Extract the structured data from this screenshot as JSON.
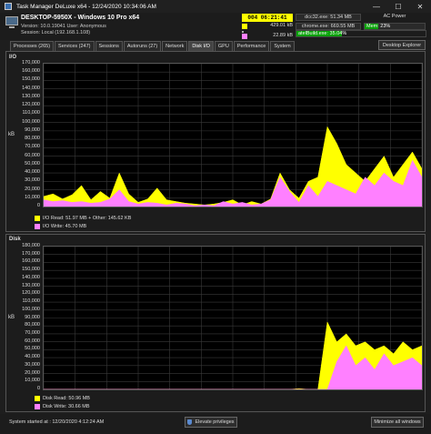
{
  "window": {
    "title": "Task Manager DeLuxe x64 - 12/24/2020 10:34:06 AM",
    "controls": [
      "—",
      "☐",
      "✕"
    ]
  },
  "system": {
    "host": "DESKTOP-5950X - Windows 10 Pro x64",
    "version_line": "Version: 10.0.19041   User: Anonymous",
    "session_line": "Session: Local (192.168.1.108)"
  },
  "status": {
    "clock": "004 06:21:41",
    "stat1_color": "#ffff00",
    "stat1_value": "429.01 kB",
    "stat2_color": "#ff80ff",
    "stat2_value": "22.89 kB",
    "top_procs": [
      "dcc32.exe: 51.34 MB",
      "chrome.exe: 669.55 MB",
      "atelBuild.exe: 35.04%"
    ],
    "power": "AC Power",
    "memory_label": "Mem: 23%",
    "memory_fraction": 0.23,
    "cpu_fraction": 0.35
  },
  "tabs": [
    {
      "label": "Processes (265)",
      "active": false
    },
    {
      "label": "Services (247)",
      "active": false
    },
    {
      "label": "Sessions",
      "active": false
    },
    {
      "label": "Autoruns (27)",
      "active": false
    },
    {
      "label": "Network",
      "active": false
    },
    {
      "label": "Disk I/O",
      "active": true
    },
    {
      "label": "GPU",
      "active": false
    },
    {
      "label": "Performance",
      "active": false
    },
    {
      "label": "System",
      "active": false
    }
  ],
  "desktop_explorer_label": "Desktop Explorer",
  "io_section": {
    "title": "I/O",
    "ylabel": "kB",
    "legend": [
      {
        "color": "#ffff00",
        "label": "I/O Read: 51.97 MB + Other: 145.62 KB"
      },
      {
        "color": "#ff80ff",
        "label": "I/O Write: 45.70 MB"
      }
    ]
  },
  "disk_section": {
    "title": "Disk",
    "ylabel": "kB",
    "legend": [
      {
        "color": "#ffff00",
        "label": "Disk Read: 50.96 MB"
      },
      {
        "color": "#ff80ff",
        "label": "Disk Write: 30.66 MB"
      }
    ]
  },
  "footer": {
    "started": "System started at : 12/20/2020 4:12:24 AM",
    "elevate": "Elevate privileges",
    "minimize": "Minimize all windows"
  },
  "chart_data": [
    {
      "type": "area",
      "title": "I/O",
      "ylabel": "kB",
      "ylim": [
        0,
        170000
      ],
      "yticks": [
        0,
        10000,
        20000,
        30000,
        40000,
        50000,
        60000,
        70000,
        80000,
        90000,
        100000,
        110000,
        120000,
        130000,
        140000,
        150000,
        160000,
        170000
      ],
      "ytick_labels": [
        "0",
        "10,000",
        "20,000",
        "30,000",
        "40,000",
        "50,000",
        "60,000",
        "70,000",
        "80,000",
        "90,000",
        "100,000",
        "110,000",
        "120,000",
        "130,000",
        "140,000",
        "150,000",
        "160,000",
        "170,000"
      ],
      "grid": true,
      "x": [
        0,
        10,
        20,
        30,
        40,
        50,
        60,
        70,
        80,
        90,
        100,
        110,
        120,
        130,
        140,
        150,
        160,
        170,
        180,
        190,
        200,
        210,
        220,
        230,
        240,
        250,
        260,
        270,
        280,
        290,
        300,
        310,
        320,
        330,
        340,
        350,
        360,
        370,
        380,
        390,
        400
      ],
      "series": [
        {
          "name": "I/O Read",
          "color": "#ffff00",
          "values": [
            12000,
            15000,
            9000,
            14000,
            25000,
            8000,
            18000,
            10000,
            40000,
            15000,
            5000,
            9000,
            22000,
            8000,
            6000,
            4000,
            3000,
            2000,
            3000,
            5000,
            8000,
            2000,
            6000,
            3000,
            9000,
            40000,
            20000,
            10000,
            30000,
            35000,
            95000,
            75000,
            50000,
            40000,
            30000,
            45000,
            60000,
            35000,
            50000,
            65000,
            45000
          ]
        },
        {
          "name": "I/O Write",
          "color": "#ff80ff",
          "values": [
            8000,
            6000,
            7000,
            5000,
            6000,
            4000,
            5000,
            9000,
            20000,
            6000,
            3000,
            5000,
            4000,
            2000,
            4000,
            3000,
            1000,
            2000,
            1000,
            6000,
            3000,
            5000,
            2000,
            3000,
            8000,
            35000,
            18000,
            5000,
            25000,
            12000,
            30000,
            25000,
            20000,
            15000,
            35000,
            25000,
            40000,
            30000,
            25000,
            55000,
            35000
          ]
        }
      ]
    },
    {
      "type": "area",
      "title": "Disk",
      "ylabel": "kB",
      "ylim": [
        0,
        180000
      ],
      "yticks": [
        0,
        10000,
        20000,
        30000,
        40000,
        50000,
        60000,
        70000,
        80000,
        90000,
        100000,
        110000,
        120000,
        130000,
        140000,
        150000,
        160000,
        170000,
        180000
      ],
      "ytick_labels": [
        "0",
        "10,000",
        "20,000",
        "30,000",
        "40,000",
        "50,000",
        "60,000",
        "70,000",
        "80,000",
        "90,000",
        "100,000",
        "110,000",
        "120,000",
        "130,000",
        "140,000",
        "150,000",
        "160,000",
        "170,000",
        "180,000"
      ],
      "grid": true,
      "x": [
        0,
        10,
        20,
        30,
        40,
        50,
        60,
        70,
        80,
        90,
        100,
        110,
        120,
        130,
        140,
        150,
        160,
        170,
        180,
        190,
        200,
        210,
        220,
        230,
        240,
        250,
        260,
        270,
        280,
        290,
        300,
        310,
        320,
        330,
        340,
        350,
        360,
        370,
        380,
        390,
        400
      ],
      "series": [
        {
          "name": "Disk Read",
          "color": "#ffff00",
          "values": [
            0,
            0,
            0,
            0,
            0,
            0,
            0,
            0,
            0,
            0,
            0,
            0,
            0,
            0,
            0,
            0,
            0,
            0,
            0,
            0,
            0,
            0,
            0,
            0,
            0,
            0,
            0,
            1000,
            0,
            0,
            85000,
            60000,
            70000,
            55000,
            60000,
            50000,
            55000,
            45000,
            60000,
            50000,
            55000
          ]
        },
        {
          "name": "Disk Write",
          "color": "#ff80ff",
          "values": [
            0,
            0,
            0,
            0,
            0,
            0,
            0,
            0,
            0,
            0,
            0,
            0,
            0,
            0,
            0,
            0,
            0,
            0,
            0,
            0,
            0,
            0,
            0,
            0,
            0,
            0,
            0,
            0,
            0,
            0,
            0,
            35000,
            55000,
            30000,
            40000,
            25000,
            45000,
            30000,
            35000,
            40000,
            30000
          ]
        }
      ]
    }
  ]
}
